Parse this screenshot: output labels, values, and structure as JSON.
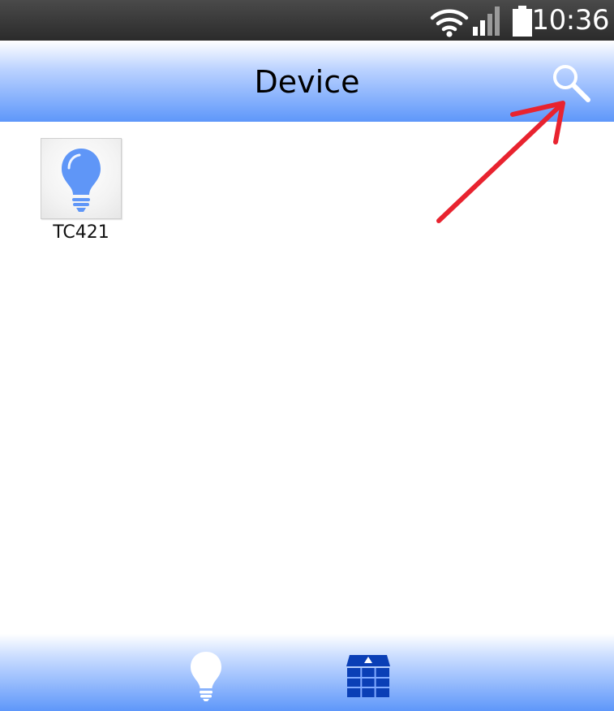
{
  "status_bar": {
    "time": "10:36",
    "icons": [
      "wifi-icon",
      "signal-icon",
      "battery-icon"
    ]
  },
  "header": {
    "title": "Device",
    "search_icon": "search-icon"
  },
  "devices": [
    {
      "name": "TC421",
      "icon": "lightbulb-icon"
    }
  ],
  "annotation": {
    "type": "red-arrow",
    "points_to": "search-icon",
    "color": "#e8232f"
  },
  "bottom_nav": {
    "tabs": [
      {
        "icon": "lightbulb-icon",
        "active": true
      },
      {
        "icon": "home-grid-icon",
        "active": false
      }
    ]
  },
  "colors": {
    "accent_blue": "#5e97fa",
    "bulb_blue": "#5f96f7",
    "nav_dark_blue": "#0a3fb6",
    "status_bar": "#333333"
  }
}
